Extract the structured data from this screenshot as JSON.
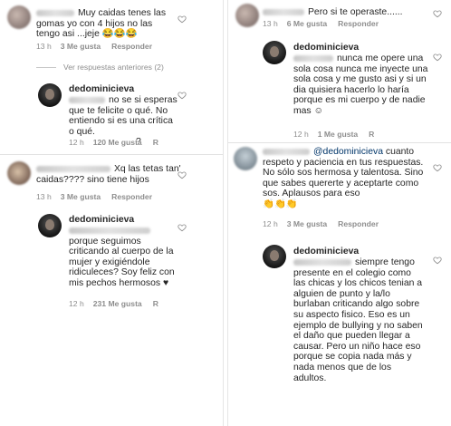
{
  "left": {
    "c1": {
      "text": "Muy caidas tenes las gomas yo con 4 hijos no las tengo asi ...jeje",
      "emoji": "😂😂😂",
      "time": "13 h",
      "likes": "3 Me gusta",
      "reply": "Responder"
    },
    "view_replies": "Ver respuestas anteriores (2)",
    "c2": {
      "user": "dedominicieva",
      "text": "no se si esperas que te felicite o qué. No entiendo si es una crítica o qué.",
      "tail": "?",
      "time": "12 h",
      "likes": "120 Me gusta",
      "reply": "R"
    },
    "c3": {
      "text": "Xq las tetas tan' caidas???? sino tiene hijos",
      "time": "13 h",
      "likes": "3 Me gusta",
      "reply": "Responder"
    },
    "c4": {
      "user": "dedominicieva",
      "text": "porque seguimos criticando al cuerpo de la mujer y exigiéndole ridiculeces? Soy feliz con mis pechos hermosos",
      "heart": "♥",
      "time": "12 h",
      "likes": "231 Me gusta",
      "reply": "R"
    }
  },
  "right": {
    "c1": {
      "text": "Pero si te operaste......",
      "time": "13 h",
      "likes": "6 Me gusta",
      "reply": "Responder"
    },
    "c2": {
      "user": "dedominicieva",
      "text": "nunca me opere una sola cosa nunca me inyecte una sola cosa y me gusto asi y si un dia quisiera hacerlo lo haría porque es mi cuerpo y de nadie mas",
      "smile": "☺",
      "time": "12 h",
      "likes": "1 Me gusta",
      "reply": "R"
    },
    "c3": {
      "mention": "@dedominicieva",
      "text": "cuanto respeto y paciencia en tus respuestas. No sólo sos hermosa y talentosa. Sino que sabes quererte y aceptarte como sos. Aplausos para eso",
      "claps": "👏👏👏",
      "time": "12 h",
      "likes": "3 Me gusta",
      "reply": "Responder"
    },
    "c4": {
      "user": "dedominicieva",
      "text": "siempre tengo presente en el colegio como las chicas y los chicos tenian a alguien de punto y la/lo burlaban criticando algo sobre su aspecto fisico. Eso es un ejemplo de bullying y no saben el daño que pueden llegar a causar. Pero un niño hace eso porque se copia nada más y nada menos que de los adultos."
    }
  }
}
